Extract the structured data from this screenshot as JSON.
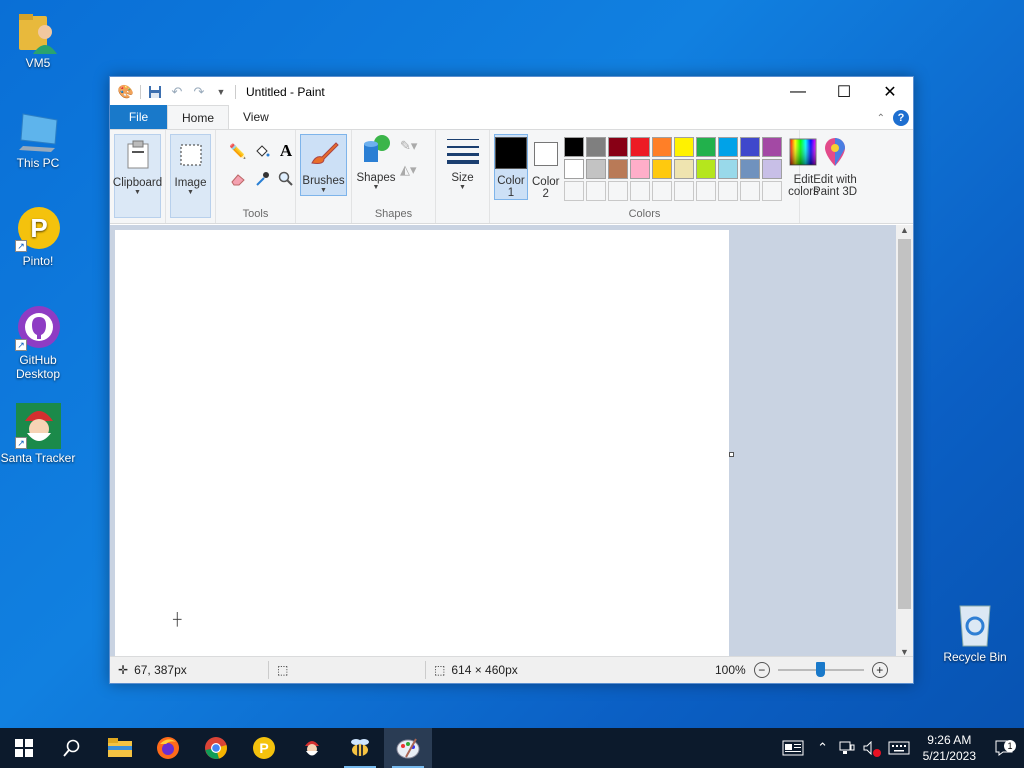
{
  "desktop": {
    "icons": [
      {
        "label": "VM5"
      },
      {
        "label": "This PC"
      },
      {
        "label": "Pinto!"
      },
      {
        "label": "GitHub Desktop"
      },
      {
        "label": "Santa Tracker"
      },
      {
        "label": "Recycle Bin"
      }
    ]
  },
  "window": {
    "title": "Untitled - Paint",
    "tabs": {
      "file": "File",
      "home": "Home",
      "view": "View"
    },
    "help": "?"
  },
  "ribbon": {
    "clipboard": {
      "label": "Clipboard"
    },
    "image": {
      "label": "Image"
    },
    "tools": {
      "group_label": "Tools"
    },
    "brushes": {
      "label": "Brushes"
    },
    "shapes": {
      "label": "Shapes",
      "group_label": "Shapes"
    },
    "size": {
      "label": "Size"
    },
    "color1": {
      "label": "Color",
      "num": "1",
      "value": "#000000"
    },
    "color2": {
      "label": "Color",
      "num": "2",
      "value": "#ffffff"
    },
    "colors_group_label": "Colors",
    "palette_row1": [
      "#000000",
      "#7f7f7f",
      "#880015",
      "#ed1c24",
      "#ff7f27",
      "#fff200",
      "#22b14c",
      "#00a2e8",
      "#3f48cc",
      "#a349a4"
    ],
    "palette_row2": [
      "#ffffff",
      "#c3c3c3",
      "#b97a57",
      "#ffaec9",
      "#ffc90e",
      "#efe4b0",
      "#b5e61d",
      "#99d9ea",
      "#7092be",
      "#c8bfe7"
    ],
    "edit_colors": {
      "line1": "Edit",
      "line2": "colors"
    },
    "paint3d": {
      "line1": "Edit with",
      "line2": "Paint 3D"
    }
  },
  "status": {
    "cursor_pos": "67, 387px",
    "canvas_size": "614 × 460px",
    "zoom": "100%",
    "zoom_level": 0.5
  },
  "taskbar": {
    "time": "9:26 AM",
    "date": "5/21/2023",
    "notification_count": "1"
  }
}
